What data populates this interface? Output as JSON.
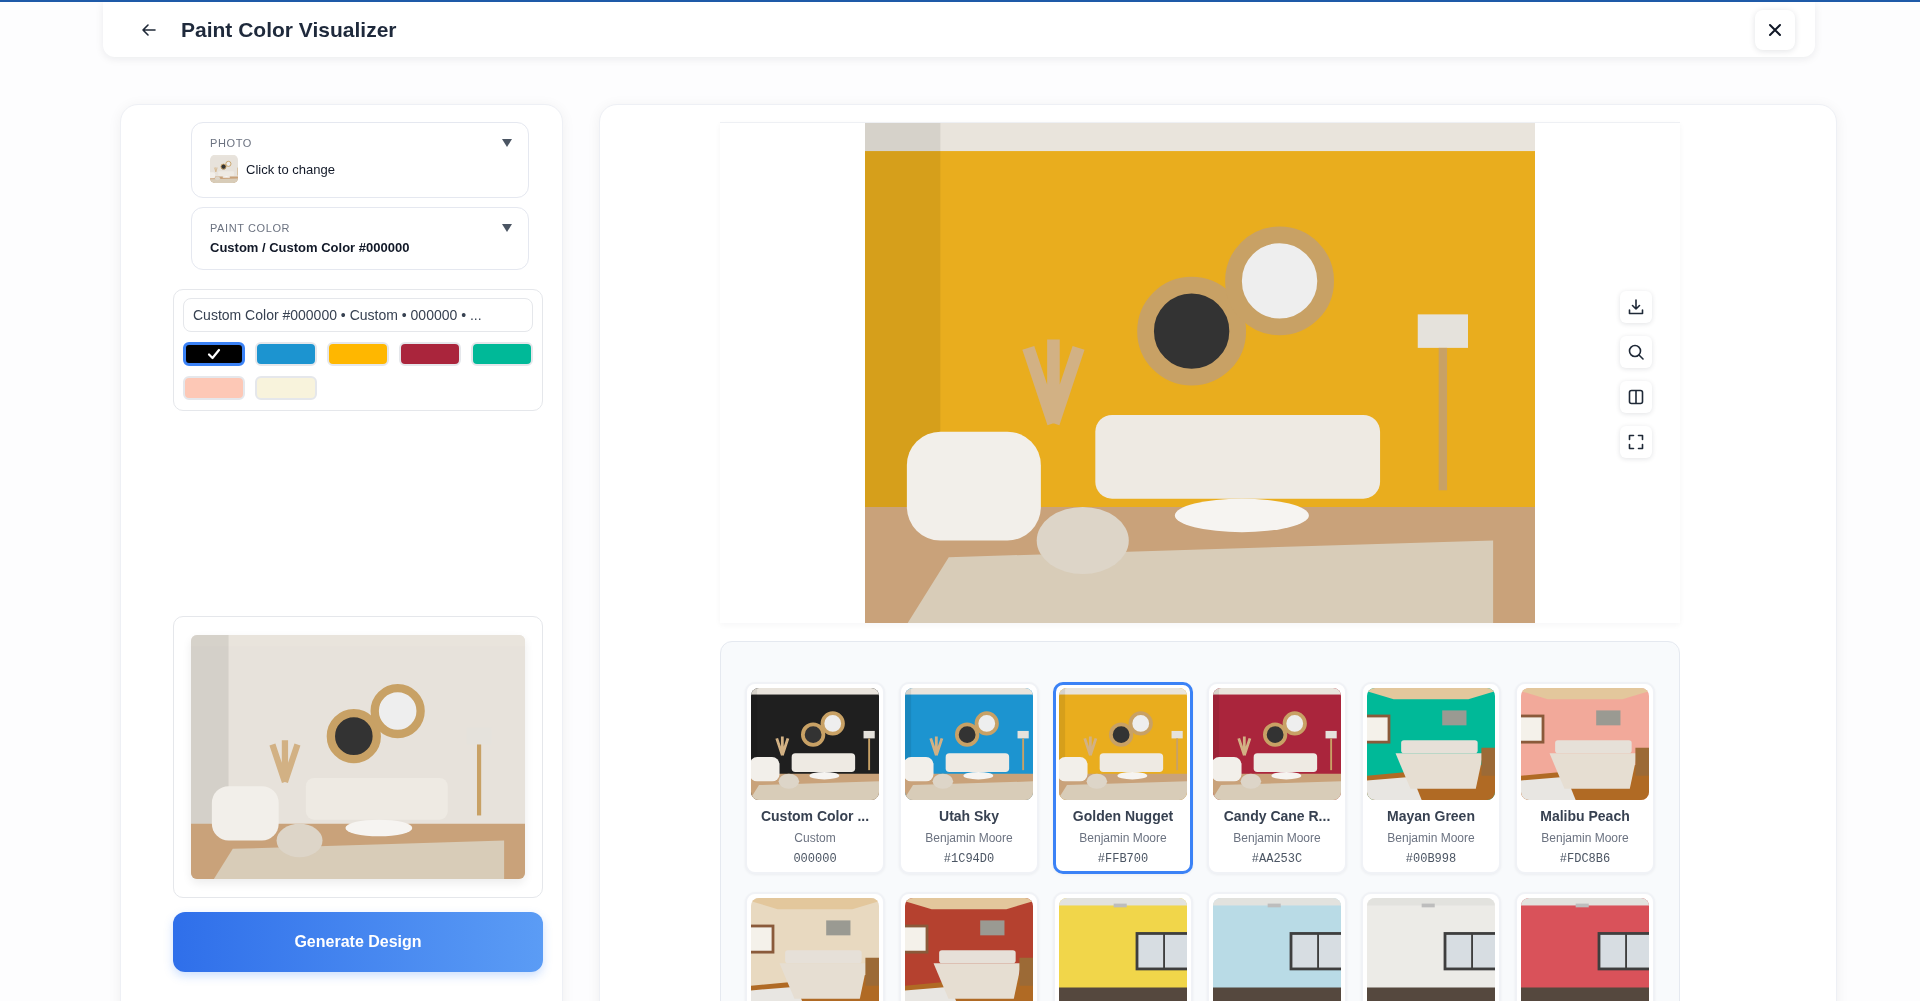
{
  "header": {
    "title": "Paint Color Visualizer"
  },
  "photo_select": {
    "label": "PHOTO",
    "value": "Click to change",
    "thumb": {
      "kind": "living",
      "color": "#e7e2db"
    }
  },
  "paint_select": {
    "label": "PAINT COLOR",
    "value": "Custom / Custom Color #000000"
  },
  "color_search": {
    "value": "Custom Color #000000 • Custom • 000000 • ..."
  },
  "swatches": [
    {
      "color": "#000000",
      "selected": true
    },
    {
      "color": "#1c94d0",
      "selected": false
    },
    {
      "color": "#ffb700",
      "selected": false
    },
    {
      "color": "#aa253c",
      "selected": false
    },
    {
      "color": "#00b998",
      "selected": false
    },
    {
      "color": "#fdc8b6",
      "selected": false
    },
    {
      "color": "#f8f3dc",
      "selected": false
    }
  ],
  "original_preview": {
    "kind": "living",
    "color": "#e7e2db"
  },
  "generate_button": "Generate Design",
  "result": {
    "kind": "living",
    "color": "#e9ad1e"
  },
  "gallery": [
    {
      "name": "Custom Color ...",
      "brand": "Custom",
      "code": "000000",
      "kind": "living",
      "color": "#1f1f1f",
      "selected": false
    },
    {
      "name": "Utah Sky",
      "brand": "Benjamin Moore",
      "code": "#1C94D0",
      "kind": "living",
      "color": "#1c94d0",
      "selected": false
    },
    {
      "name": "Golden Nugget",
      "brand": "Benjamin Moore",
      "code": "#FFB700",
      "kind": "living",
      "color": "#e9ad1e",
      "selected": true
    },
    {
      "name": "Candy Cane R...",
      "brand": "Benjamin Moore",
      "code": "#AA253C",
      "kind": "living",
      "color": "#aa253c",
      "selected": false
    },
    {
      "name": "Mayan Green",
      "brand": "Benjamin Moore",
      "code": "#00B998",
      "kind": "bedroom",
      "color": "#00b998",
      "selected": false
    },
    {
      "name": "Malibu Peach",
      "brand": "Benjamin Moore",
      "code": "#FDC8B6",
      "kind": "bedroom",
      "color": "#f2a99a",
      "selected": false
    }
  ],
  "gallery_more": [
    {
      "kind": "bedroom",
      "color": "#e8d9c0"
    },
    {
      "kind": "bedroom",
      "color": "#b5412f"
    },
    {
      "kind": "empty",
      "color": "#f1d64a"
    },
    {
      "kind": "empty",
      "color": "#b9dbe6"
    },
    {
      "kind": "empty",
      "color": "#ecebe7"
    },
    {
      "kind": "empty",
      "color": "#d9525a"
    }
  ]
}
